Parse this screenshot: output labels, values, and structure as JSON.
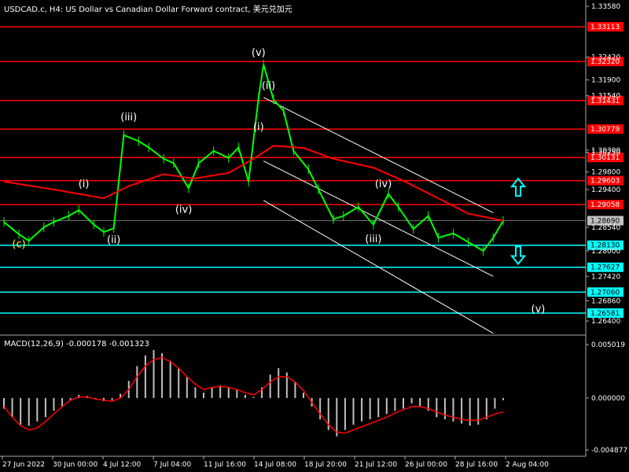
{
  "header": {
    "title": "USDCAD.c, H4:  US Dollar vs Canadian Dollar Forward contract, 美元兑加元"
  },
  "macd": {
    "label": "MACD(12,26,9) -0.000178 -0.001323",
    "yticks": [
      "0.005019",
      "0.000000",
      "-0.004877"
    ],
    "ylim": [
      -0.004877,
      0.005019
    ]
  },
  "colors": {
    "background": "#000000",
    "price": "#00ff00",
    "ma": "#ff0000",
    "resistance": "#ff0000",
    "support": "#00ffff",
    "channel": "#ffffff",
    "macd_hist": "#c0c0c0",
    "macd_signal": "#ff0000",
    "current_price": "#707070"
  },
  "chart_data": {
    "type": "line",
    "symbol": "USDCAD.c",
    "timeframe": "H4",
    "ylim": [
      1.2633,
      1.3358
    ],
    "yticks": [
      "1.33580",
      "1.32420",
      "1.31900",
      "1.31540",
      "1.30300",
      "1.30250",
      "1.29800",
      "1.29400",
      "1.28540",
      "1.28000",
      "1.27420",
      "1.26860",
      "1.26400"
    ],
    "xticks": [
      "27 Jun 2022",
      "30 Jun 00:00",
      "4 Jul 12:00",
      "7 Jul 04:00",
      "11 Jul 16:00",
      "14 Jul 08:00",
      "18 Jul 20:00",
      "21 Jul 12:00",
      "26 Jul 00:00",
      "28 Jul 16:00",
      "2 Aug 04:00"
    ],
    "price_series": [
      {
        "t": 0.0,
        "v": 1.2866
      },
      {
        "t": 0.03,
        "v": 1.2838
      },
      {
        "t": 0.05,
        "v": 1.2823
      },
      {
        "t": 0.08,
        "v": 1.2854
      },
      {
        "t": 0.1,
        "v": 1.2866
      },
      {
        "t": 0.13,
        "v": 1.288
      },
      {
        "t": 0.15,
        "v": 1.2893
      },
      {
        "t": 0.18,
        "v": 1.286
      },
      {
        "t": 0.2,
        "v": 1.2843
      },
      {
        "t": 0.22,
        "v": 1.2852
      },
      {
        "t": 0.24,
        "v": 1.3064
      },
      {
        "t": 0.27,
        "v": 1.305
      },
      {
        "t": 0.29,
        "v": 1.3036
      },
      {
        "t": 0.32,
        "v": 1.301
      },
      {
        "t": 0.34,
        "v": 1.3
      },
      {
        "t": 0.37,
        "v": 1.2943
      },
      {
        "t": 0.39,
        "v": 1.3
      },
      {
        "t": 0.42,
        "v": 1.3028
      },
      {
        "t": 0.45,
        "v": 1.3012
      },
      {
        "t": 0.47,
        "v": 1.3036
      },
      {
        "t": 0.49,
        "v": 1.2958
      },
      {
        "t": 0.51,
        "v": 1.315
      },
      {
        "t": 0.52,
        "v": 1.3225
      },
      {
        "t": 0.54,
        "v": 1.3145
      },
      {
        "t": 0.56,
        "v": 1.312
      },
      {
        "t": 0.58,
        "v": 1.3028
      },
      {
        "t": 0.61,
        "v": 1.2986
      },
      {
        "t": 0.63,
        "v": 1.294
      },
      {
        "t": 0.66,
        "v": 1.2872
      },
      {
        "t": 0.68,
        "v": 1.288
      },
      {
        "t": 0.71,
        "v": 1.29
      },
      {
        "t": 0.74,
        "v": 1.286
      },
      {
        "t": 0.77,
        "v": 1.293
      },
      {
        "t": 0.79,
        "v": 1.29
      },
      {
        "t": 0.82,
        "v": 1.285
      },
      {
        "t": 0.85,
        "v": 1.288
      },
      {
        "t": 0.87,
        "v": 1.283
      },
      {
        "t": 0.9,
        "v": 1.284
      },
      {
        "t": 0.93,
        "v": 1.282
      },
      {
        "t": 0.96,
        "v": 1.28
      },
      {
        "t": 0.98,
        "v": 1.283
      },
      {
        "t": 1.0,
        "v": 1.2869
      }
    ],
    "ma_series": [
      {
        "t": 0.0,
        "v": 1.2958
      },
      {
        "t": 0.1,
        "v": 1.294
      },
      {
        "t": 0.2,
        "v": 1.292
      },
      {
        "t": 0.25,
        "v": 1.2948
      },
      {
        "t": 0.32,
        "v": 1.2975
      },
      {
        "t": 0.38,
        "v": 1.2965
      },
      {
        "t": 0.45,
        "v": 1.2978
      },
      {
        "t": 0.5,
        "v": 1.301
      },
      {
        "t": 0.54,
        "v": 1.304
      },
      {
        "t": 0.6,
        "v": 1.3035
      },
      {
        "t": 0.66,
        "v": 1.301
      },
      {
        "t": 0.74,
        "v": 1.299
      },
      {
        "t": 0.8,
        "v": 1.296
      },
      {
        "t": 0.87,
        "v": 1.292
      },
      {
        "t": 0.93,
        "v": 1.2885
      },
      {
        "t": 1.0,
        "v": 1.2869
      }
    ],
    "horizontal_levels": [
      {
        "value": "1.33113",
        "kind": "resistance"
      },
      {
        "value": "1.32320",
        "kind": "resistance"
      },
      {
        "value": "1.31431",
        "kind": "resistance"
      },
      {
        "value": "1.30779",
        "kind": "resistance"
      },
      {
        "value": "1.30131",
        "kind": "resistance"
      },
      {
        "value": "1.29603",
        "kind": "resistance"
      },
      {
        "value": "1.29058",
        "kind": "resistance"
      },
      {
        "value": "1.28130",
        "kind": "support"
      },
      {
        "value": "1.27627",
        "kind": "support"
      },
      {
        "value": "1.27060",
        "kind": "support"
      },
      {
        "value": "1.26581",
        "kind": "support"
      }
    ],
    "current_price": "1.28690",
    "channel": {
      "upper": [
        {
          "t": 0.52,
          "v": 1.315
        },
        {
          "t": 0.98,
          "v": 1.2887
        }
      ],
      "middle": [
        {
          "t": 0.52,
          "v": 1.3005
        },
        {
          "t": 0.98,
          "v": 1.2742
        }
      ],
      "lower": [
        {
          "t": 0.52,
          "v": 1.2915
        },
        {
          "t": 0.98,
          "v": 1.2612
        }
      ]
    },
    "wave_labels": [
      {
        "text": "(c)",
        "t": 0.03,
        "v": 1.2808,
        "color": "#ffff00"
      },
      {
        "text": "(i)",
        "t": 0.16,
        "v": 1.2945,
        "color": "#ffffff"
      },
      {
        "text": "(ii)",
        "t": 0.22,
        "v": 1.2818,
        "color": "#ffffff"
      },
      {
        "text": "(iii)",
        "t": 0.25,
        "v": 1.3098,
        "color": "#ffffff"
      },
      {
        "text": "(iv)",
        "t": 0.36,
        "v": 1.2887,
        "color": "#ffffff"
      },
      {
        "text": "(v)",
        "t": 0.51,
        "v": 1.3245,
        "color": "#ffffff"
      },
      {
        "text": "(ii)",
        "t": 0.53,
        "v": 1.317,
        "color": "#ffffff"
      },
      {
        "text": "(i)",
        "t": 0.51,
        "v": 1.3075,
        "color": "#ffffff"
      },
      {
        "text": "(iii)",
        "t": 0.74,
        "v": 1.282,
        "color": "#ffffff"
      },
      {
        "text": "(iv)",
        "t": 0.76,
        "v": 1.2945,
        "color": "#ffffff"
      },
      {
        "text": "(v)",
        "t": 1.07,
        "v": 1.266,
        "color": "#ffffff"
      }
    ],
    "arrows": [
      {
        "direction": "up",
        "t": 1.03,
        "v": 1.2945
      },
      {
        "direction": "down",
        "t": 1.03,
        "v": 1.279
      }
    ]
  },
  "macd_data": {
    "histogram": [
      -0.001,
      -0.0018,
      -0.0025,
      -0.0026,
      -0.0022,
      -0.0018,
      -0.0012,
      -0.0008,
      -0.0002,
      0.0003,
      0.0002,
      -0.0001,
      -0.0003,
      -0.0002,
      0.0004,
      0.0016,
      0.003,
      0.004,
      0.0045,
      0.0042,
      0.0035,
      0.0028,
      0.002,
      0.001,
      0.0005,
      0.001,
      0.0012,
      0.001,
      0.0008,
      0.0003,
      0.0001,
      0.001,
      0.0022,
      0.0028,
      0.0024,
      0.0015,
      0.0005,
      -0.0008,
      -0.002,
      -0.003,
      -0.0036,
      -0.003,
      -0.0025,
      -0.0022,
      -0.002,
      -0.0018,
      -0.0015,
      -0.0012,
      -0.001,
      -0.0005,
      -0.0008,
      -0.0012,
      -0.0018,
      -0.002,
      -0.0022,
      -0.0024,
      -0.0026,
      -0.0025,
      -0.002,
      -0.001,
      -0.0002
    ],
    "signal": [
      -0.0008,
      -0.0018,
      -0.0026,
      -0.003,
      -0.0028,
      -0.0022,
      -0.0015,
      -0.0008,
      -0.0002,
      0.0001,
      0.0001,
      -0.0001,
      -0.0002,
      -0.0003,
      0.0,
      0.0008,
      0.002,
      0.003,
      0.0036,
      0.0038,
      0.0034,
      0.0028,
      0.002,
      0.0013,
      0.0008,
      0.001,
      0.0011,
      0.001,
      0.0008,
      0.0005,
      0.0003,
      0.0008,
      0.0015,
      0.002,
      0.002,
      0.0015,
      0.0007,
      -0.0004,
      -0.0015,
      -0.0025,
      -0.0032,
      -0.0033,
      -0.003,
      -0.0027,
      -0.0024,
      -0.0021,
      -0.0018,
      -0.0014,
      -0.0011,
      -0.0008,
      -0.0008,
      -0.001,
      -0.0013,
      -0.0016,
      -0.0018,
      -0.002,
      -0.0021,
      -0.0021,
      -0.0018,
      -0.0015,
      -0.0013
    ]
  }
}
